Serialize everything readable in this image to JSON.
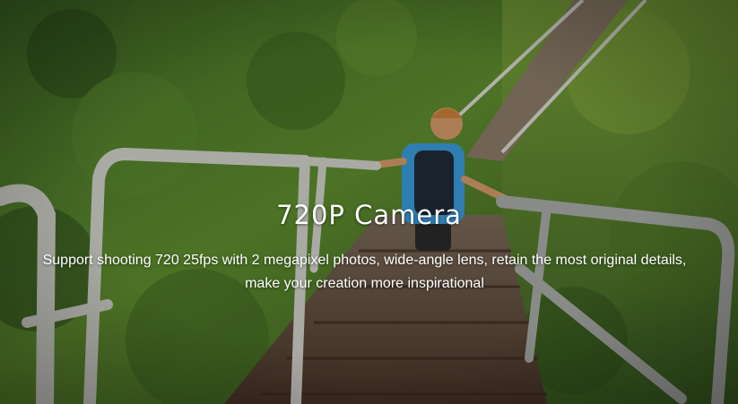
{
  "hero": {
    "title": "720P Camera",
    "description": "Support shooting 720 25fps with 2 megapixel photos, wide-angle lens, retain the most original details, make your creation more inspirational"
  },
  "colors": {
    "text": "#ffffff",
    "foliage_dark": "#2f4f1f",
    "foliage_light": "#6f9a3a",
    "rail": "#cfcfc8",
    "stairs": "#5a4436",
    "shirt": "#3a9ad8"
  }
}
